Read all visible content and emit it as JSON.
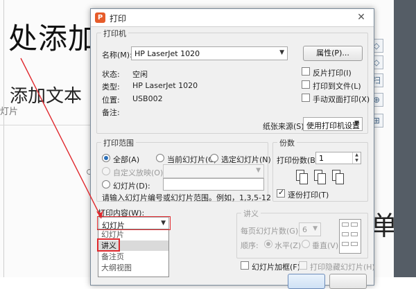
{
  "background": {
    "slide_title": "处添加",
    "slide_subtitle": "添加文本",
    "slide_small": "灯片",
    "slide_right_text": "单击",
    "right_tools": [
      "◇",
      "扫",
      "⊕",
      "⊞"
    ]
  },
  "dialog": {
    "app_icon": "P",
    "title": "打印",
    "close_glyph": "✕",
    "printer": {
      "group_label": "打印机",
      "name_label": "名称(M):",
      "name_value": "HP LaserJet 1020",
      "properties_button": "属性(P)...",
      "status_label": "状态:",
      "status_value": "空闲",
      "type_label": "类型:",
      "type_value": "HP LaserJet 1020",
      "location_label": "位置:",
      "location_value": "USB002",
      "comment_label": "备注:",
      "reverse_print": "反片打印(I)",
      "print_to_file": "打印到文件(L)",
      "manual_duplex": "手动双面打印(X)",
      "paper_source_label": "纸张来源(S):",
      "paper_source_value": "使用打印机设置"
    },
    "range": {
      "group_label": "打印范围",
      "all": "全部(A)",
      "current_slide": "当前幻灯片(C)",
      "selected_slides": "选定幻灯片(N)",
      "custom_show": "自定义放映(O):",
      "slides": "幻灯片(D):",
      "hint": "请输入幻灯片编号或幻灯片范围。例如，1,3,5-12"
    },
    "copies": {
      "group_label": "份数",
      "count_label": "打印份数(B):",
      "count_value": "1",
      "collate": "逐份打印(T)"
    },
    "content": {
      "label": "打印内容(W):",
      "selected": "幻灯片",
      "options": [
        "幻灯片",
        "讲义",
        "备注页",
        "大纲视图"
      ],
      "highlighted_option": "讲义"
    },
    "handout": {
      "group_label": "讲义",
      "per_page_label": "每页幻灯片数(G):",
      "per_page_value": "6",
      "order_label": "顺序:",
      "horizontal": "水平(Z)",
      "vertical": "垂直(V)"
    },
    "options": {
      "frame_slides": "幻灯片加框(F)",
      "print_hidden": "打印隐藏幻灯片(H)"
    }
  },
  "colors": {
    "annotation_red": "#e0282d",
    "app_icon": "#e65c2b"
  }
}
